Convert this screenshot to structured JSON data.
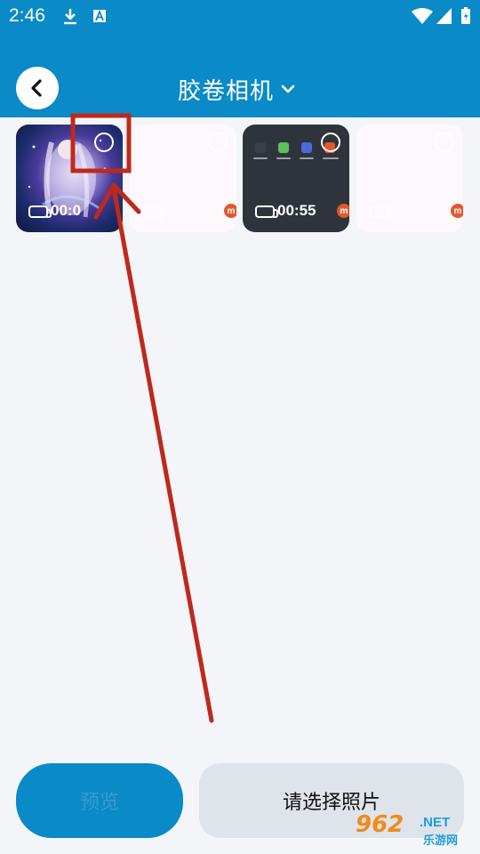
{
  "statusbar": {
    "time": "2:46",
    "icons": [
      "download-icon",
      "a-badge-icon",
      "wifi-icon",
      "cellular-icon",
      "battery-charging-icon"
    ]
  },
  "header": {
    "title": "胶卷相机",
    "back_icon": "chevron-left-icon",
    "title_dropdown_icon": "chevron-down-icon",
    "bg_color": "#0a8ac6"
  },
  "gallery": {
    "items": [
      {
        "kind": "video",
        "duration": "00:0",
        "thumbnail": "anime-girl-artwork",
        "selectable": true
      },
      {
        "kind": "video",
        "duration": "",
        "thumbnail": "blank",
        "selectable": true
      },
      {
        "kind": "video",
        "duration": "00:55",
        "thumbnail": "phone-home-screen",
        "selectable": true
      },
      {
        "kind": "video",
        "duration": "",
        "thumbnail": "blank",
        "selectable": true
      }
    ],
    "badge_letter": "m"
  },
  "annotation": {
    "color": "#c0281c",
    "shapes": [
      "highlight-box",
      "pointer-arrow"
    ]
  },
  "footer": {
    "preview_label": "预览",
    "select_label": "请选择照片"
  },
  "watermark": {
    "brand_number": "962",
    "brand_domain": ".NET",
    "brand_cn": "乐游网"
  }
}
